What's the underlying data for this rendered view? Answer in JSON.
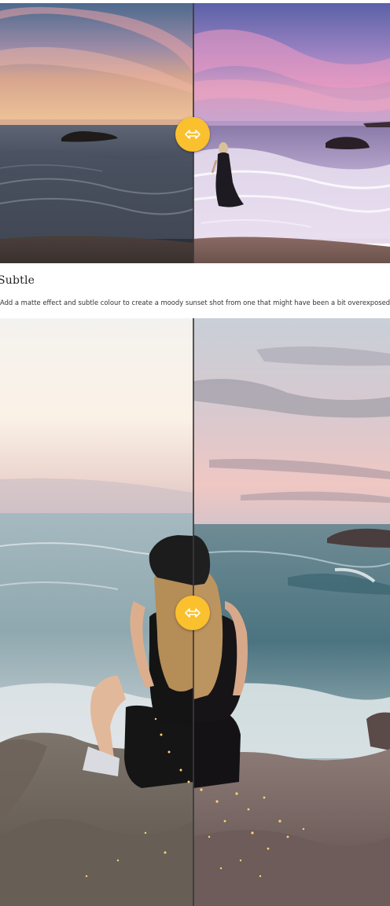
{
  "slider_top": {
    "before_label": "before-image",
    "after_label": "after-image",
    "handle_icon": "horizontal-arrows-icon",
    "handle_color": "#fbc02d"
  },
  "section": {
    "title": "Subtle",
    "description": "Add a matte effect and subtle colour to create a moody sunset shot from one that might have been a bit overexposed."
  },
  "slider_bottom": {
    "before_label": "before-image",
    "after_label": "after-image",
    "handle_icon": "horizontal-arrows-icon",
    "handle_color": "#fbc02d"
  }
}
